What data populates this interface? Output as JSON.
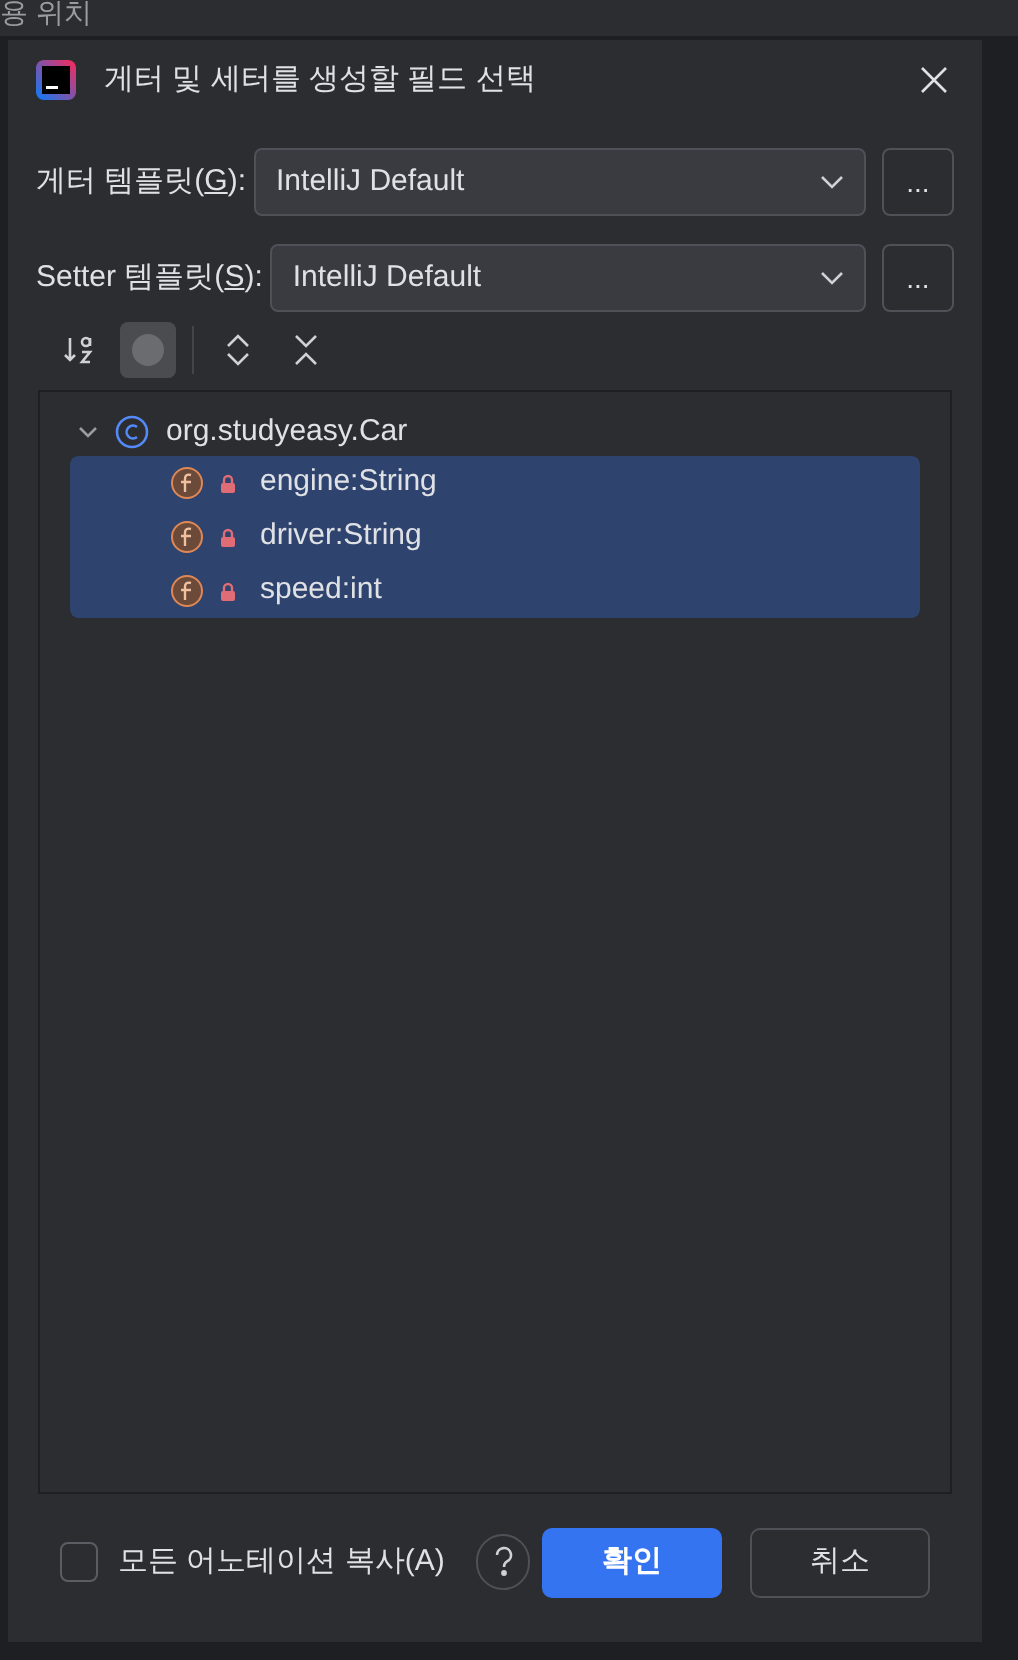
{
  "background_text": "용 위치",
  "dialog": {
    "title": "게터 및 세터를 생성할 필드 선택"
  },
  "templates": [
    {
      "label_start": "게터 템플릿(",
      "mnemonic": "G",
      "label_end": "):",
      "value": "IntelliJ Default",
      "more": "..."
    },
    {
      "label_start": "Setter 템플릿(",
      "mnemonic": "S",
      "label_end": "):",
      "value": "IntelliJ Default",
      "more": "..."
    }
  ],
  "toolbar": [
    {
      "kind": "sort",
      "selected": false
    },
    {
      "kind": "circle",
      "selected": true
    },
    {
      "kind": "expand",
      "selected": false
    },
    {
      "kind": "collapse",
      "selected": false
    }
  ],
  "tree": {
    "label": "org.studyeasy.Car",
    "expanded": true,
    "children": [
      {
        "label": "engine:String",
        "selected": true
      },
      {
        "label": "driver:String",
        "selected": true
      },
      {
        "label": "speed:int",
        "selected": true
      }
    ]
  },
  "copy_annotations": {
    "label": "모든 어노테이션 복사(A)",
    "checked": false
  },
  "buttons": [
    {
      "label": "확인",
      "kind": "primary"
    },
    {
      "label": "취소",
      "kind": "secondary"
    }
  ]
}
